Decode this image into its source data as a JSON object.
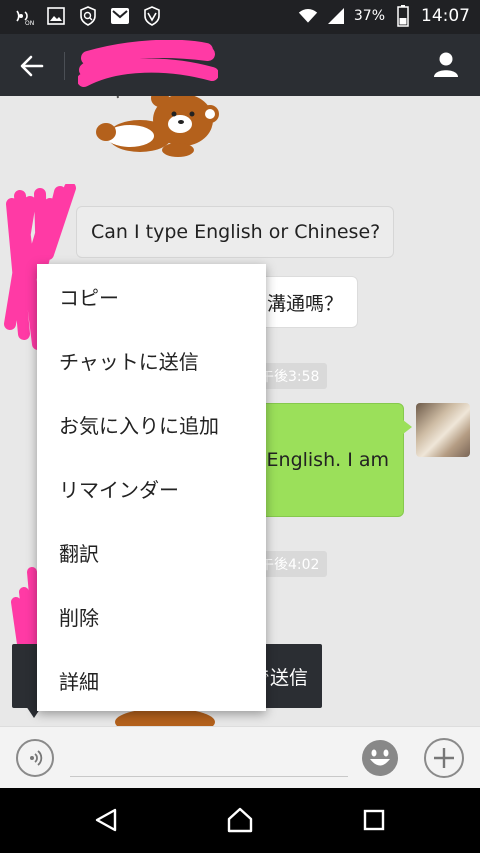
{
  "status_bar": {
    "icons": [
      "signal-nfc-icon",
      "image-icon",
      "shield-search-icon",
      "mail-icon",
      "vpn-shield-icon"
    ],
    "battery": "37%",
    "time": "14:07"
  },
  "header": {
    "contact_name": "",
    "back_icon": "arrow-left-icon",
    "profile_icon": "person-icon"
  },
  "messages": [
    {
      "type": "sticker",
      "name": "rilakkuma-sticker"
    },
    {
      "type": "incoming",
      "text": "Can I type English or Chinese?"
    },
    {
      "type": "incoming",
      "text": "溝通嗎？"
    },
    {
      "type": "timestamp",
      "text": "午後3:58"
    },
    {
      "type": "outgoing",
      "text": "English. I am"
    },
    {
      "type": "timestamp",
      "text": "午後4:02"
    },
    {
      "type": "incoming-dark",
      "text": "で送信"
    }
  ],
  "context_menu": {
    "items": [
      {
        "label": "コピー"
      },
      {
        "label": "チャットに送信"
      },
      {
        "label": "お気に入りに追加"
      },
      {
        "label": "リマインダー"
      },
      {
        "label": "翻訳"
      },
      {
        "label": "削除"
      },
      {
        "label": "詳細"
      }
    ]
  },
  "input_bar": {
    "placeholder": "",
    "voice_icon": "voice-icon",
    "emoji_icon": "emoji-icon",
    "add_icon": "plus-icon"
  },
  "nav": {
    "back": "nav-back-icon",
    "home": "nav-home-icon",
    "recents": "nav-recents-icon"
  },
  "colors": {
    "header": "#2b2e33",
    "outgoing_bubble": "#9be05a",
    "censor": "#ff3aa5"
  }
}
